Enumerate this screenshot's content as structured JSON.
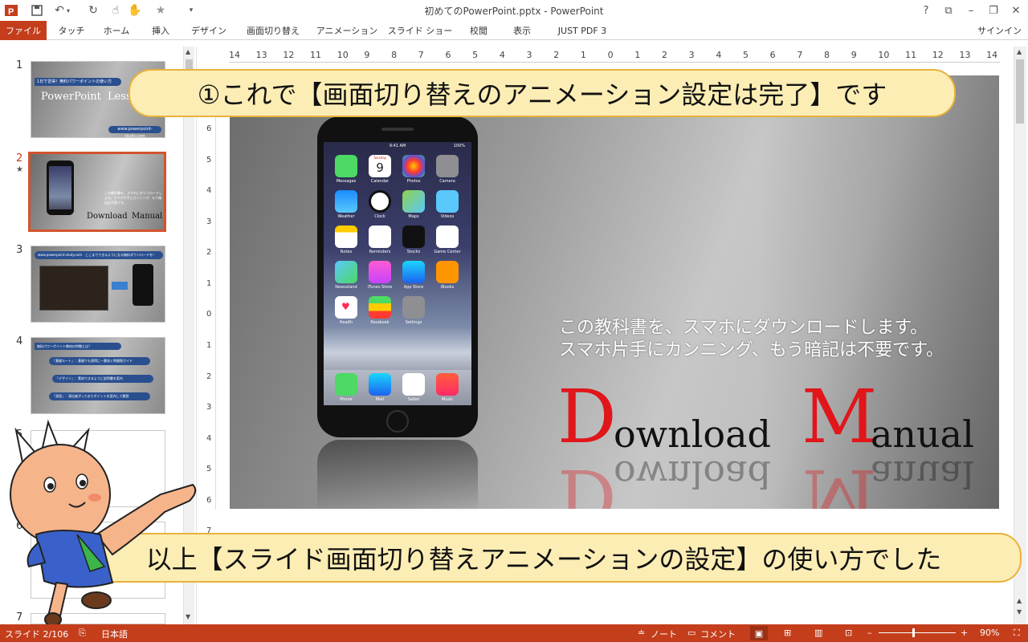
{
  "window": {
    "title": "初めてのPowerPoint.pptx - PowerPoint",
    "help": "?",
    "controls": [
      "🗗",
      "–",
      "🗗",
      "✕"
    ]
  },
  "qat": {
    "app_icon": "powerpoint-icon",
    "save": "save-icon",
    "undo": "undo-icon",
    "redo": "redo-icon",
    "touch": "touch-mode-icon",
    "star": "star-icon",
    "more": "customize-icon"
  },
  "ribbon": {
    "tabs": [
      "ファイル",
      "タッチ",
      "ホーム",
      "挿入",
      "デザイン",
      "画面切り替え",
      "アニメーション",
      "スライド ショー",
      "校閲",
      "表示",
      "JUST PDF 3"
    ],
    "signin": "サインイン"
  },
  "thumbnails": [
    {
      "num": "1",
      "title": "1日で習得！無料パワーポイントの使い方",
      "logo_word1": "PowerPoint",
      "logo_word2": "Lesson",
      "url": "www.powerpoint-study.com"
    },
    {
      "num": "2",
      "star": "★",
      "text": "この教科書を、スマホにダウンロードします。スマホ片手にカンニング、もう暗記は不要です。",
      "logo_word1": "Download",
      "logo_word2": "Manual"
    },
    {
      "num": "3",
      "url": "www.powerpoint-study.com",
      "title": "ここまでできるようになる無料ダウンロードを！"
    },
    {
      "num": "4",
      "title": "無料パワーポイント教材の特徴とは？",
      "items": [
        "「基礎ルート」：基礎でも習得に一番効く時間割ガイド",
        "「デザイン」：素材できるように説明書を案内",
        "「演習」：演出者がっておりポイントを案内して解説"
      ]
    },
    {
      "num": "5"
    },
    {
      "num": "6"
    },
    {
      "num": "7"
    }
  ],
  "ruler": {
    "h_labels": [
      "14",
      "13",
      "12",
      "11",
      "10",
      "9",
      "8",
      "7",
      "6",
      "5",
      "4",
      "3",
      "2",
      "1",
      "0",
      "1",
      "2",
      "3",
      "4",
      "5",
      "6",
      "7",
      "8",
      "9",
      "10",
      "11",
      "12",
      "13",
      "14"
    ],
    "v_labels": [
      "6",
      "5",
      "4",
      "3",
      "2",
      "1",
      "0",
      "1",
      "2",
      "3",
      "4",
      "5",
      "6",
      "7"
    ]
  },
  "slide": {
    "line1": "この教科書を、スマホにダウンロードします。",
    "line2": "スマホ片手にカンニング、もう暗記は不要です。",
    "big1": "D",
    "word1": "ownload",
    "big2": "M",
    "word2": "anual",
    "phone": {
      "status_time": "9:41 AM",
      "status_battery": "100%",
      "calendar_day": "Tuesday",
      "calendar_date": "9",
      "apps": [
        "Messages",
        "Calendar",
        "Photos",
        "Camera",
        "Weather",
        "Clock",
        "Maps",
        "Videos",
        "Notes",
        "Reminders",
        "Stocks",
        "Game Center",
        "Newsstand",
        "iTunes Store",
        "App Store",
        "iBooks",
        "Health",
        "Passbook",
        "Settings"
      ],
      "dock": [
        "Phone",
        "Mail",
        "Safari",
        "Music"
      ]
    }
  },
  "callouts": {
    "top": "①これで【画面切り替えのアニメーション設定は完了】です",
    "bottom": "以上【スライド画面切り替えアニメーションの設定】の使い方でした"
  },
  "status": {
    "slide_counter": "スライド 2/106",
    "language": "日本語",
    "notes": "ノート",
    "comments": "コメント",
    "zoom": "90%",
    "zoom_minus": "–",
    "zoom_plus": "+"
  },
  "colors": {
    "accent": "#c43e1c",
    "callout_fill": "#fcedb4",
    "callout_border": "#e8b23a",
    "logo_red": "#e0161b"
  }
}
